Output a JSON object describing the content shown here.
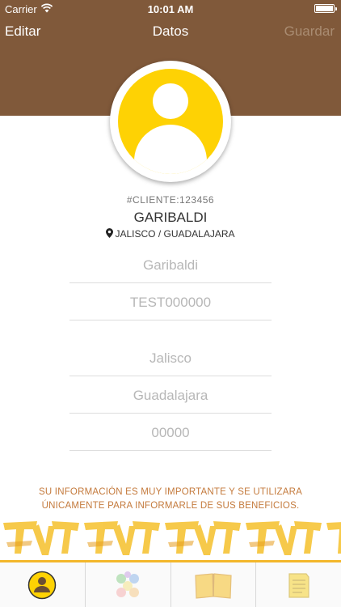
{
  "status_bar": {
    "carrier": "Carrier",
    "time": "10:01 AM"
  },
  "nav": {
    "left": "Editar",
    "title": "Datos",
    "right": "Guardar"
  },
  "profile": {
    "client_id": "#CLIENTE:123456",
    "name": "GARIBALDI",
    "location": "JALISCO / GUADALAJARA"
  },
  "form": {
    "fields": [
      {
        "name": "name-field",
        "placeholder": "Garibaldi"
      },
      {
        "name": "code-field",
        "placeholder": "TEST000000"
      },
      {
        "name": "state-field",
        "placeholder": "Jalisco"
      },
      {
        "name": "city-field",
        "placeholder": "Guadalajara"
      },
      {
        "name": "zip-field",
        "placeholder": "00000"
      }
    ]
  },
  "info_text": "SU INFORMACIÓN ES MUY IMPORTANTE Y SE UTILIZARA ÚNICAMENTE PARA INFORMARLE DE SUS BENEFICIOS.",
  "tabs": [
    {
      "icon": "profile-icon",
      "selected": true
    },
    {
      "icon": "categories-icon",
      "selected": false
    },
    {
      "icon": "book-icon",
      "selected": false
    },
    {
      "icon": "notes-icon",
      "selected": false
    }
  ],
  "colors": {
    "header": "#80593a",
    "avatar": "#fed204",
    "info_text": "#c47a3c",
    "accent_line": "#f3b72b",
    "save_disabled": "#a98c72"
  }
}
